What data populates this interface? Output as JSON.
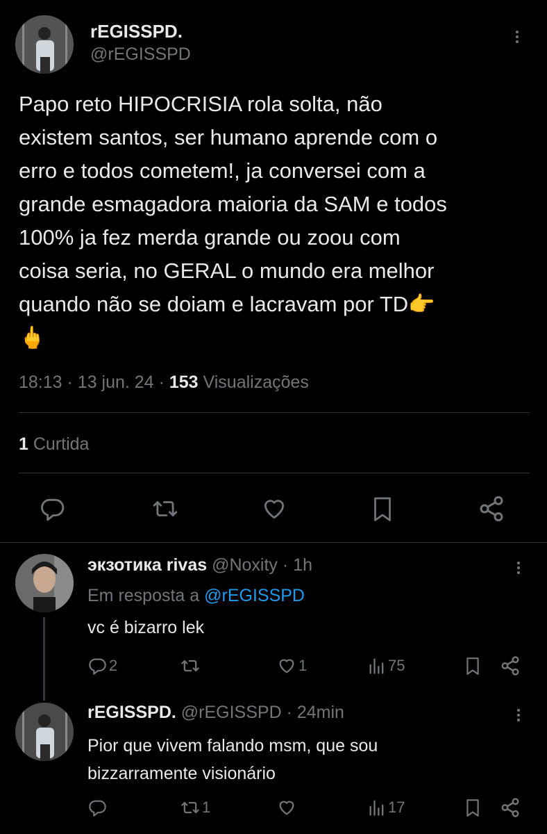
{
  "main_post": {
    "display_name": "rEGISSPD.",
    "handle": "@rEGISSPD",
    "text_lines": [
      "Papo reto HIPOCRISIA rola solta, não",
      "existem santos, ser humano aprende com o",
      "erro e todos cometem!, ja conversei com a",
      "grande esmagadora maioria da SAM e todos",
      "100% ja fez merda grande ou zoou com",
      "coisa seria, no GERAL o mundo era melhor",
      "quando não se doiam e lacravam por TD👉",
      "🖕"
    ],
    "time": "18:13",
    "date": "13 jun. 24",
    "views_count": "153",
    "views_label": "Visualizações",
    "likes_count": "1",
    "likes_label": "Curtida"
  },
  "replies": [
    {
      "display_name": "экзотика rivas",
      "handle": "@Noxity",
      "time": "1h",
      "replying_prefix": "Em resposta a",
      "replying_to": "@rEGISSPD",
      "text_lines": [
        "vc é bizarro lek"
      ],
      "reply_count": "2",
      "repost_count": "",
      "like_count": "1",
      "views": "75"
    },
    {
      "display_name": "rEGISSPD.",
      "handle": "@rEGISSPD",
      "time": "24min",
      "text_lines": [
        "Pior que vivem falando msm, que sou",
        "bizzarramente visionário"
      ],
      "reply_count": "",
      "repost_count": "1",
      "like_count": "",
      "views": "17"
    }
  ],
  "icons": {
    "reply": "reply-icon",
    "repost": "repost-icon",
    "like": "heart-icon",
    "bookmark": "bookmark-icon",
    "share": "share-icon",
    "views": "views-icon",
    "more": "more-icon"
  },
  "colors": {
    "background": "#000000",
    "text": "#e7e9ea",
    "muted": "#71767b",
    "accent": "#1d9bf0",
    "divider": "#2f3336"
  }
}
